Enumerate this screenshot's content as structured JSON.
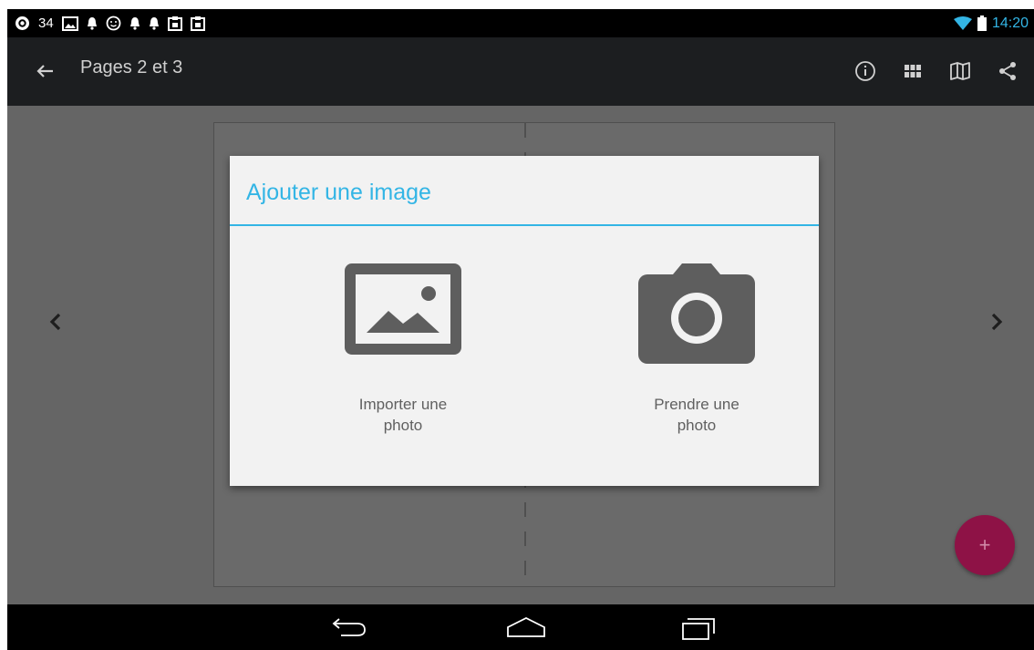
{
  "status_bar": {
    "notification_count": "34",
    "time": "14:20",
    "icons": [
      "sync-icon",
      "photo-icon",
      "bell-icon",
      "smiley-icon",
      "bell-icon",
      "bell-icon",
      "clipboard-icon",
      "clipboard-icon",
      "wifi-icon",
      "battery-icon"
    ]
  },
  "action_bar": {
    "title": "Pages 2 et 3",
    "actions": [
      "info-icon",
      "grid-icon",
      "book-icon",
      "share-icon"
    ]
  },
  "dialog": {
    "title": "Ajouter une image",
    "options": [
      {
        "label_line1": "Importer une",
        "label_line2": "photo",
        "icon": "image-icon"
      },
      {
        "label_line1": "Prendre une",
        "label_line2": "photo",
        "icon": "camera-icon"
      }
    ]
  },
  "fab": {
    "label": "+"
  },
  "colors": {
    "accent": "#33b5e5",
    "fab": "#8e1246",
    "scrim": "#656565",
    "dialog_bg": "#f2f2f2",
    "icon_gray": "#5e5e5e"
  }
}
